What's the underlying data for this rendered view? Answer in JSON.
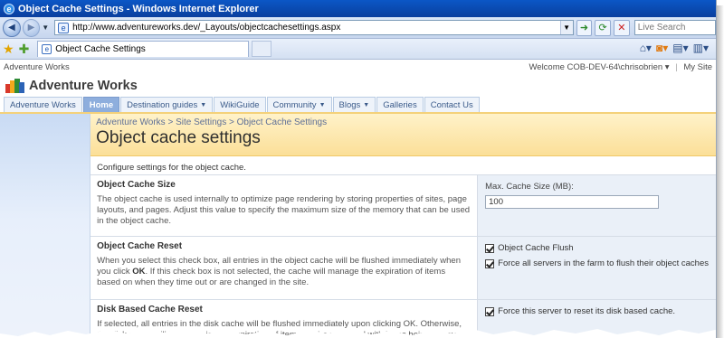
{
  "browser": {
    "window_title": "Object Cache Settings - Windows Internet Explorer",
    "address_url": "http://www.adventureworks.dev/_Layouts/objectcachesettings.aspx",
    "search_placeholder": "Live Search",
    "tab_title": "Object Cache Settings"
  },
  "site": {
    "top_site_link": "Adventure Works",
    "welcome_text": "Welcome COB-DEV-64\\chrisobrien",
    "my_site_link": "My Site",
    "site_title": "Adventure Works",
    "nav_tabs": [
      {
        "label": "Adventure Works"
      },
      {
        "label": "Home"
      },
      {
        "label": "Destination guides"
      },
      {
        "label": "WikiGuide"
      },
      {
        "label": "Community"
      },
      {
        "label": "Blogs"
      },
      {
        "label": "Galleries"
      },
      {
        "label": "Contact Us"
      }
    ],
    "logo_colors": [
      "#d9392b",
      "#f2a81d",
      "#2e8b37",
      "#2c63b6"
    ]
  },
  "page": {
    "breadcrumb": [
      "Adventure Works",
      "Site Settings",
      "Object Cache Settings"
    ],
    "breadcrumb_sep": ">",
    "title": "Object cache settings",
    "description": "Configure settings for the object cache."
  },
  "sections": {
    "size": {
      "title": "Object Cache Size",
      "description": "The object cache is used internally to optimize page rendering by storing properties of sites, page layouts, and pages.  Adjust this value to specify the maximum size of the memory that can be used in the object cache.",
      "field_label": "Max. Cache Size (MB):",
      "field_value": "100"
    },
    "reset": {
      "title": "Object Cache Reset",
      "desc_a": "When you select this check box, all entries in the object cache will be flushed immediately when you click ",
      "desc_ok": "OK",
      "desc_b": ". If this check box is not selected, the cache will manage the expiration of items based on when they time out or are changed in the site.",
      "checkbox_flush": "Object Cache Flush",
      "checkbox_all_servers": "Force all servers in the farm to flush their object caches"
    },
    "disk": {
      "title": "Disk Based Cache Reset",
      "description": "If selected, all entries in the disk cache will be flushed immediately upon clicking OK. Otherwise, the disk cache will be left as is and expiration of items will be managed with items being removed as",
      "checkbox_reset": "Force this server to reset its disk based cache."
    }
  }
}
